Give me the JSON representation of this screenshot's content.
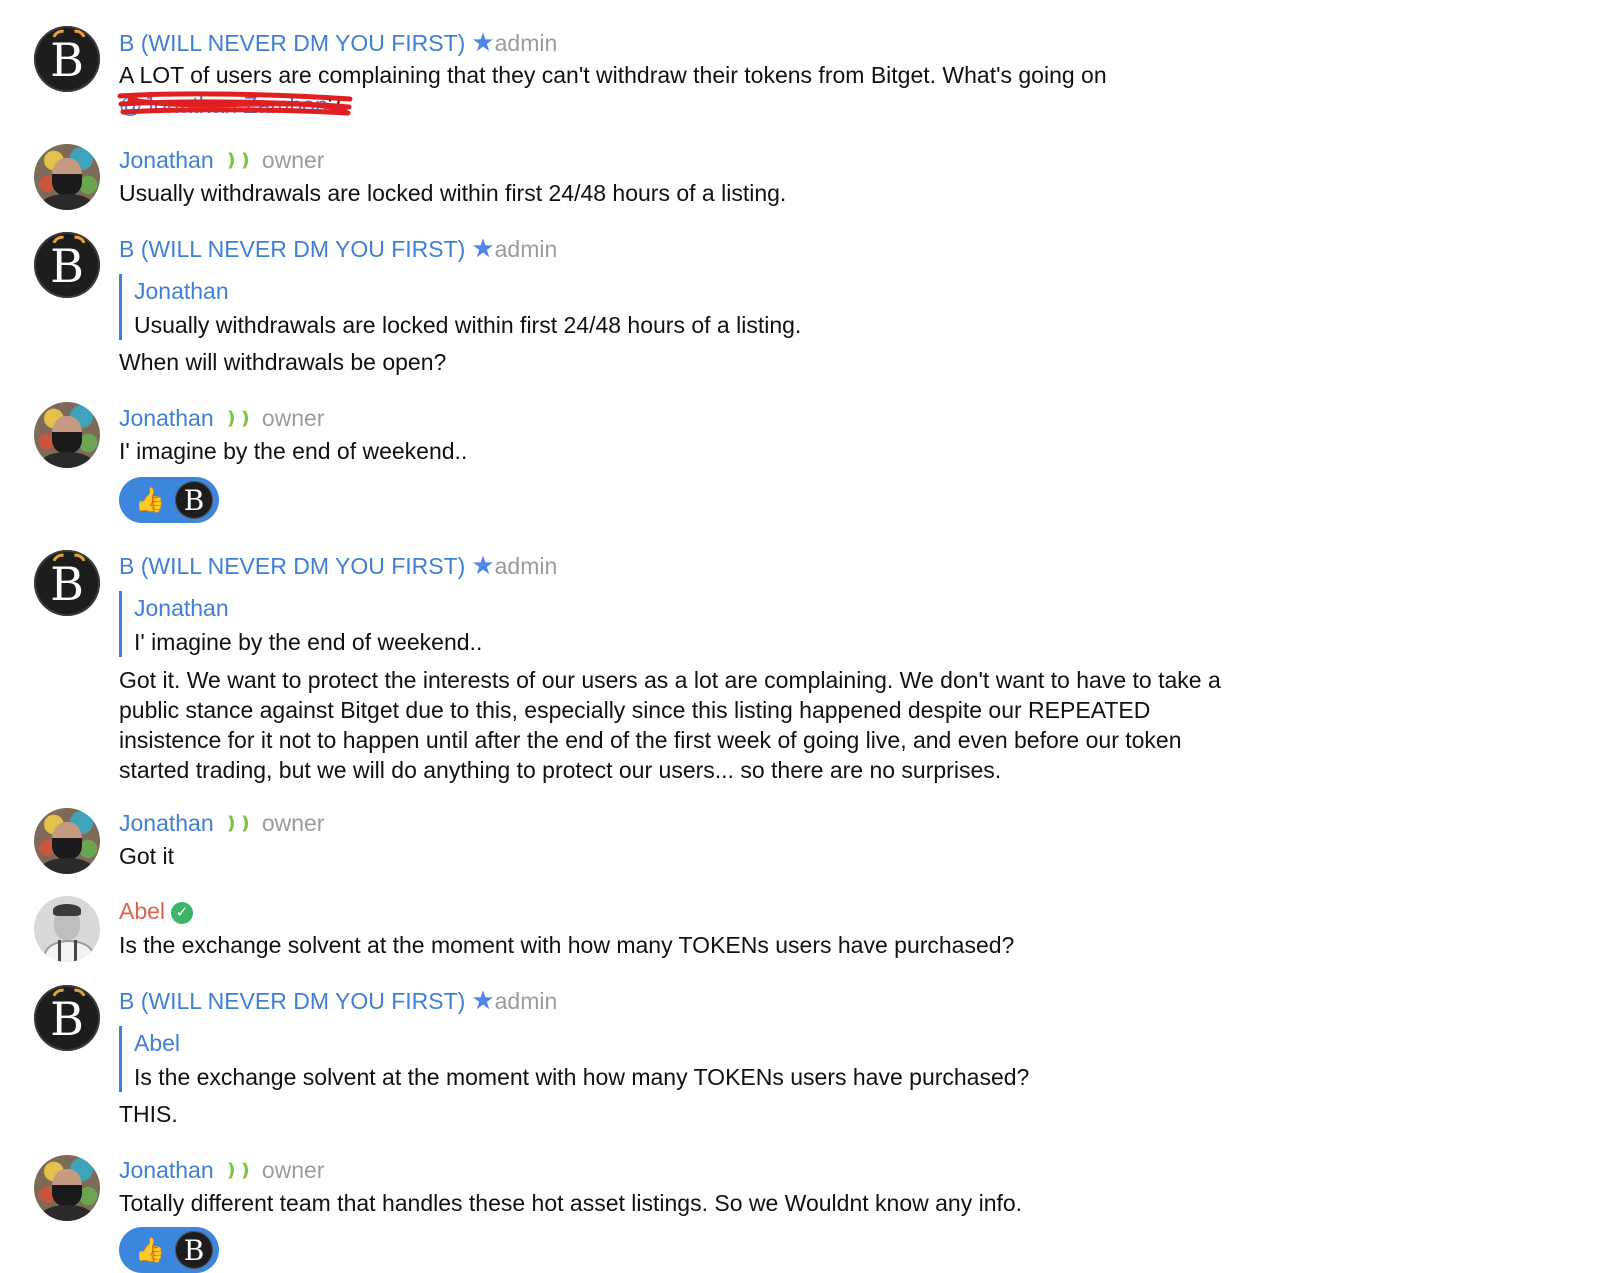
{
  "users": {
    "b": {
      "name": "B (WILL NEVER DM YOU FIRST)",
      "role": "admin",
      "avatar_letter": "B"
    },
    "jonathan": {
      "name": "Jonathan",
      "role": "owner"
    },
    "abel": {
      "name": "Abel"
    }
  },
  "messages": [
    {
      "text": "A LOT of users are complaining that they can't withdraw their tokens from Bitget. What's going on",
      "mention": "@Jonathan Zambon",
      "mention_suffix": "?"
    },
    {
      "text": "Usually withdrawals are locked within first 24/48 hours of a listing."
    },
    {
      "reply_to_name": "Jonathan",
      "reply_to_text": "Usually withdrawals are locked within first 24/48 hours of a listing.",
      "text": "When will withdrawals be open?"
    },
    {
      "text": "I' imagine by the end of weekend..",
      "reaction_emoji": "👍",
      "reaction_avatar": "B"
    },
    {
      "reply_to_name": "Jonathan",
      "reply_to_text": "I' imagine by the end of weekend..",
      "lines": [
        "Got it. We want to protect the interests of our users as a lot are complaining. We don't want to have to take a",
        "public stance against Bitget due to this, especially since this listing happened despite our REPEATED",
        "insistence for it not to happen until after the end of the first week of going live, and even before our token",
        "started trading, but we will do anything to protect our users... so there are no surprises."
      ]
    },
    {
      "text": "Got it"
    },
    {
      "text": "Is the exchange solvent at the moment with how many TOKENs users have purchased?"
    },
    {
      "reply_to_name": "Abel",
      "reply_to_text": "Is the exchange solvent at the moment with how many TOKENs users have purchased?",
      "text": "THIS."
    },
    {
      "text": "Totally different team that handles these hot asset listings. So we Wouldnt know any info.",
      "reaction_emoji": "👍",
      "reaction_avatar": "B"
    }
  ],
  "icons": {
    "admin_badge": "star-icon",
    "owner_badge": "owner-signal-icon",
    "verified_badge": "verified-check-icon"
  },
  "colors": {
    "name_blue": "#3f7fd6",
    "abel_name": "#e0624b",
    "owner_green": "#7dc242",
    "reaction_bg": "#3d86dd",
    "redaction_red": "#e02020"
  }
}
